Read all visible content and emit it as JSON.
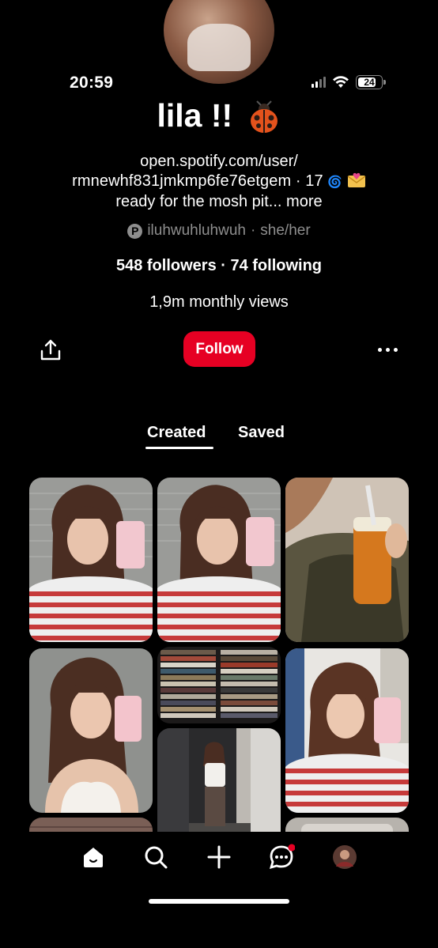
{
  "status_bar": {
    "time": "20:59",
    "battery": "24"
  },
  "profile": {
    "name": "lila !!",
    "name_emoji": "ladybug",
    "bio_line1": "open.spotify.com/user/",
    "bio_line2": "rmnewhf831jmkmp6fe76etgem · 17",
    "bio_line3": "ready for the mosh pit...",
    "bio_more": "more",
    "username": "iluhwuhluhwuh",
    "pronouns": "she/her",
    "follow_counts": "548 followers · 74 following",
    "monthly_views": "1,9m monthly views"
  },
  "actions": {
    "follow_label": "Follow"
  },
  "tabs": [
    {
      "label": "Created",
      "active": true
    },
    {
      "label": "Saved",
      "active": false
    }
  ],
  "colors": {
    "accent": "#e60023",
    "background": "#000000",
    "muted": "#8e8e8e"
  },
  "pins": [
    "mirror-selfie-striped-shirt",
    "mirror-selfie-striped-shirt",
    "drink-closeup-green-jacket",
    "mirror-selfie-white-top",
    "cd-stacks",
    "full-body-mirror-selfie",
    "mirror-selfie-striped-shirt-hallway"
  ],
  "nav": [
    "home-icon",
    "search-icon",
    "create-icon",
    "messages-icon",
    "profile-avatar"
  ]
}
